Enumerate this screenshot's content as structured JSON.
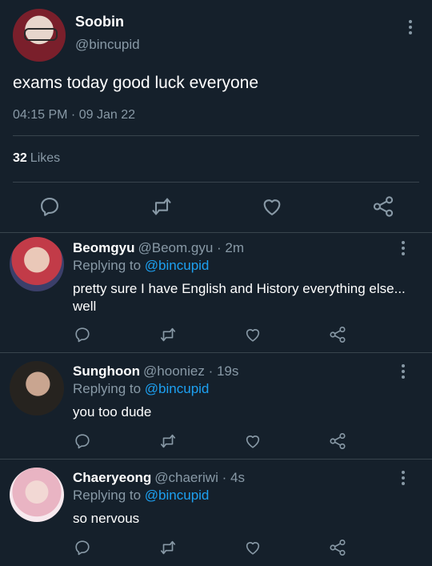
{
  "main": {
    "display_name": "Soobin",
    "handle": "@bincupid",
    "text": "exams today good luck everyone",
    "timestamp": "04:15 PM · 09 Jan 22",
    "likes_count": "32",
    "likes_label": "Likes"
  },
  "replies": [
    {
      "name": "Beomgyu",
      "handle": "@Beom.gyu",
      "time": "· 2m",
      "replying_prefix": "Replying to",
      "replying_to": "@bincupid",
      "text": "pretty sure I have English and History everything else... well"
    },
    {
      "name": "Sunghoon",
      "handle": "@hooniez",
      "time": "· 19s",
      "replying_prefix": "Replying to",
      "replying_to": "@bincupid",
      "text": "you too dude"
    },
    {
      "name": "Chaeryeong",
      "handle": "@chaeriwi",
      "time": "· 4s",
      "replying_prefix": "Replying to",
      "replying_to": "@bincupid",
      "text": "so nervous"
    }
  ],
  "colors": {
    "background": "#15202b",
    "secondary_text": "#8899a6",
    "accent": "#1da1f2",
    "divider": "#38444d"
  },
  "icons": [
    "comment-icon",
    "retweet-icon",
    "heart-icon",
    "share-icon",
    "more-icon"
  ]
}
